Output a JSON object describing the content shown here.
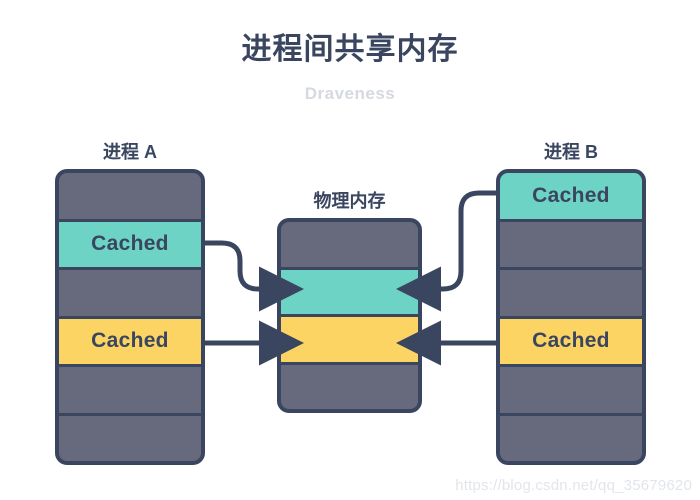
{
  "header": {
    "title": "进程间共享内存",
    "subtitle": "Draveness"
  },
  "colors": {
    "ink": "#3a4660",
    "gray": "#676a7c",
    "teal": "#6dd3c4",
    "yellow": "#fcd463",
    "background": "#ffffff",
    "subtitle": "#d6d9e0",
    "watermark": "#e2e5ea"
  },
  "diagram": {
    "process_a": {
      "label": "进程 A",
      "rows": [
        {
          "fill": "gray",
          "text": ""
        },
        {
          "fill": "teal",
          "text": "Cached"
        },
        {
          "fill": "gray",
          "text": ""
        },
        {
          "fill": "yellow",
          "text": "Cached"
        },
        {
          "fill": "gray",
          "text": ""
        },
        {
          "fill": "gray",
          "text": ""
        }
      ]
    },
    "physical_memory": {
      "label": "物理内存",
      "rows": [
        {
          "fill": "gray",
          "text": ""
        },
        {
          "fill": "teal",
          "text": ""
        },
        {
          "fill": "yellow",
          "text": ""
        },
        {
          "fill": "gray",
          "text": ""
        }
      ]
    },
    "process_b": {
      "label": "进程 B",
      "rows": [
        {
          "fill": "teal",
          "text": "Cached"
        },
        {
          "fill": "gray",
          "text": ""
        },
        {
          "fill": "gray",
          "text": ""
        },
        {
          "fill": "yellow",
          "text": "Cached"
        },
        {
          "fill": "gray",
          "text": ""
        },
        {
          "fill": "gray",
          "text": ""
        }
      ]
    },
    "connectors": [
      {
        "name": "a-teal-to-physical",
        "from": "process-a-row-2",
        "to": "physical-teal-row",
        "style": "curved"
      },
      {
        "name": "a-yellow-to-physical",
        "from": "process-a-row-4",
        "to": "physical-yellow-row",
        "style": "straight"
      },
      {
        "name": "b-teal-to-physical",
        "from": "process-b-row-1",
        "to": "physical-teal-row",
        "style": "curved"
      },
      {
        "name": "b-yellow-to-physical",
        "from": "process-b-row-4",
        "to": "physical-yellow-row",
        "style": "straight"
      }
    ]
  },
  "watermark": {
    "text": "https://blog.csdn.net/qq_35679620"
  }
}
